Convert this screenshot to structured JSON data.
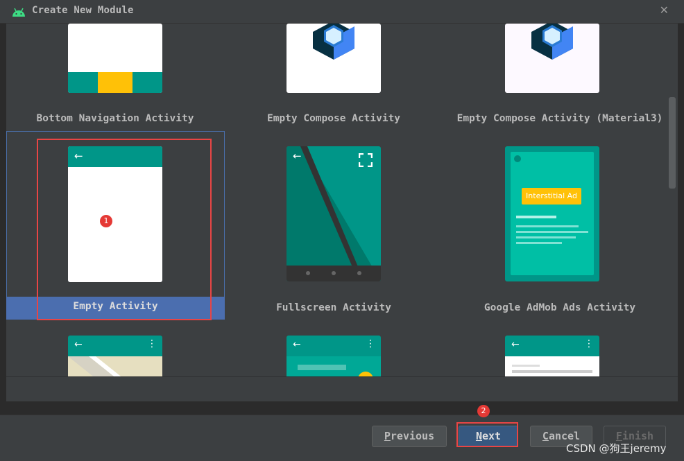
{
  "window": {
    "title": "Create New Module",
    "close_glyph": "✕",
    "icon": "android-icon"
  },
  "templates": [
    {
      "label": "Bottom Navigation Activity",
      "selected": false
    },
    {
      "label": "Empty Compose Activity",
      "selected": false
    },
    {
      "label": "Empty Compose Activity (Material3)",
      "selected": false
    },
    {
      "label": "Empty Activity",
      "selected": true
    },
    {
      "label": "Fullscreen Activity",
      "selected": false
    },
    {
      "label": "Google AdMob Ads Activity",
      "selected": false
    }
  ],
  "admob_preview": {
    "ad_label": "Interstitial Ad"
  },
  "buttons": {
    "previous": {
      "mnemonic": "P",
      "rest": "revious"
    },
    "next": {
      "mnemonic": "N",
      "rest": "ext"
    },
    "cancel": {
      "mnemonic": "C",
      "rest": "ancel"
    },
    "finish": {
      "mnemonic": "F",
      "rest": "inish"
    }
  },
  "annotations": {
    "badge1": "1",
    "badge2": "2"
  },
  "watermark": "CSDN @狗王jeremy",
  "colors": {
    "teal": "#009688",
    "selection": "#4b6eaf",
    "primary_button": "#365880",
    "annotation_red": "#e84545"
  }
}
